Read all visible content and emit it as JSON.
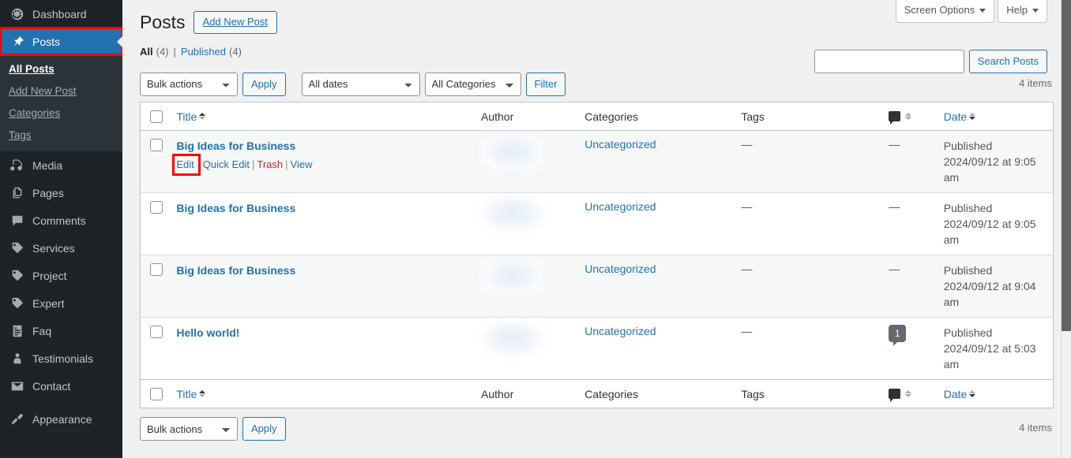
{
  "sidebar": {
    "items": [
      {
        "label": "Dashboard",
        "icon": "dashboard-icon",
        "current": false
      },
      {
        "label": "Posts",
        "icon": "pin-icon",
        "current": true,
        "highlighted": true
      },
      {
        "label": "Media",
        "icon": "media-icon",
        "current": false
      },
      {
        "label": "Pages",
        "icon": "pages-icon",
        "current": false
      },
      {
        "label": "Comments",
        "icon": "comment-icon",
        "current": false
      },
      {
        "label": "Services",
        "icon": "tag-icon",
        "current": false
      },
      {
        "label": "Project",
        "icon": "tag-icon",
        "current": false
      },
      {
        "label": "Expert",
        "icon": "tag-icon",
        "current": false
      },
      {
        "label": "Faq",
        "icon": "list-icon",
        "current": false
      },
      {
        "label": "Testimonials",
        "icon": "user-icon",
        "current": false
      },
      {
        "label": "Contact",
        "icon": "mail-icon",
        "current": false
      },
      {
        "label": "Appearance",
        "icon": "brush-icon",
        "current": false
      }
    ],
    "submenu": [
      {
        "label": "All Posts",
        "current": true
      },
      {
        "label": "Add New Post",
        "current": false
      },
      {
        "label": "Categories",
        "current": false
      },
      {
        "label": "Tags",
        "current": false
      }
    ]
  },
  "screen_meta": {
    "screen_options": "Screen Options",
    "help": "Help"
  },
  "header": {
    "title": "Posts",
    "add_new": "Add New Post"
  },
  "views": {
    "all_label": "All",
    "all_count": "(4)",
    "separator": "|",
    "published_label": "Published",
    "published_count": "(4)"
  },
  "search": {
    "value": "",
    "placeholder": "",
    "button": "Search Posts"
  },
  "tablenav_top": {
    "bulk_actions": "Bulk actions",
    "apply": "Apply",
    "all_dates": "All dates",
    "all_categories": "All Categories",
    "filter": "Filter",
    "items": "4 items"
  },
  "tablenav_bottom": {
    "bulk_actions": "Bulk actions",
    "apply": "Apply",
    "items": "4 items"
  },
  "columns": {
    "title": "Title",
    "author": "Author",
    "categories": "Categories",
    "tags": "Tags",
    "comments": "Comments",
    "date": "Date"
  },
  "row_actions": {
    "edit": "Edit",
    "quick_edit": "Quick Edit",
    "trash": "Trash",
    "view": "View"
  },
  "rows": [
    {
      "title": "Big Ideas for Business",
      "author": "",
      "categories": "Uncategorized",
      "tags": "—",
      "comments": "—",
      "date_status": "Published",
      "date_value": "2024/09/12 at 9:05 am",
      "has_actions": true,
      "edit_highlighted": true
    },
    {
      "title": "Big Ideas for Business",
      "author": "",
      "categories": "Uncategorized",
      "tags": "—",
      "comments": "—",
      "date_status": "Published",
      "date_value": "2024/09/12 at 9:05 am",
      "has_actions": false,
      "edit_highlighted": false
    },
    {
      "title": "Big Ideas for Business",
      "author": "",
      "categories": "Uncategorized",
      "tags": "—",
      "comments": "—",
      "date_status": "Published",
      "date_value": "2024/09/12 at 9:04 am",
      "has_actions": false,
      "edit_highlighted": false
    },
    {
      "title": "Hello world!",
      "author": "",
      "categories": "Uncategorized",
      "tags": "—",
      "comments": "1",
      "date_status": "Published",
      "date_value": "2024/09/12 at 5:03 am",
      "has_actions": false,
      "edit_highlighted": false
    }
  ],
  "colors": {
    "accent": "#2271b1",
    "sidebar_bg": "#1d2327",
    "submenu_bg": "#2c3338",
    "page_bg": "#f0f0f1",
    "highlight": "#ff0000",
    "trash": "#b32d2e"
  }
}
